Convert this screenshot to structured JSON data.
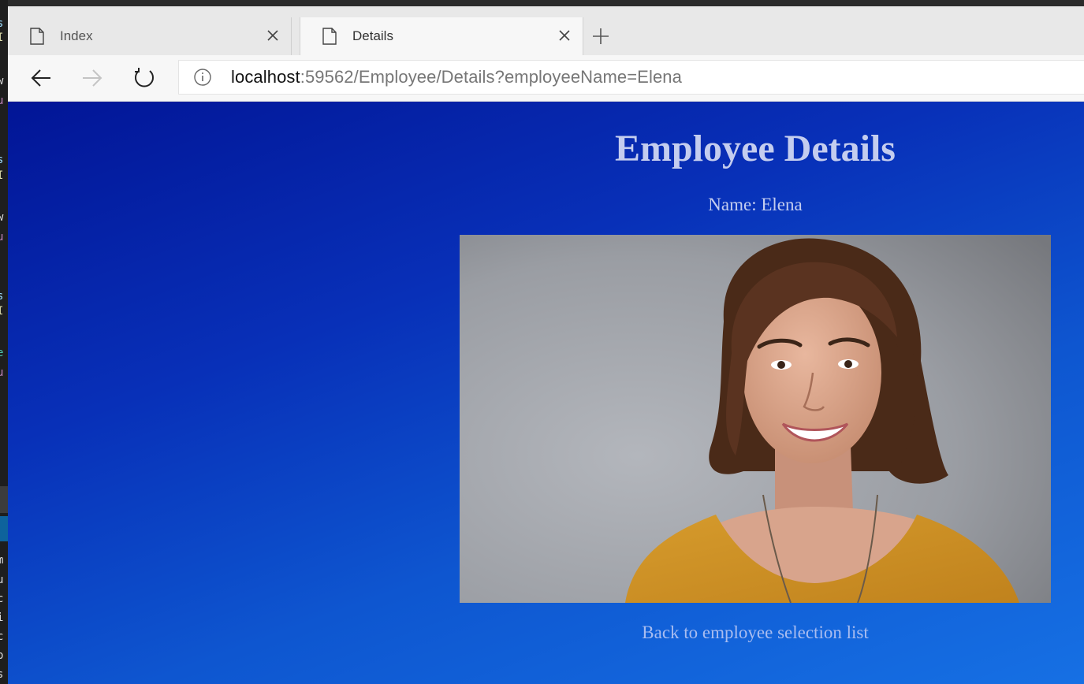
{
  "tabs": [
    {
      "label": "Index",
      "active": false
    },
    {
      "label": "Details",
      "active": true
    }
  ],
  "address_bar": {
    "host": "localhost",
    "rest": ":59562/Employee/Details?employeeName=Elena"
  },
  "page": {
    "title": "Employee Details",
    "name_line": "Name: Elena",
    "back_link": "Back to employee selection list"
  },
  "colors": {
    "background_gradient_start": "#021596",
    "background_gradient_end": "#1670e4",
    "heading_text": "#c4cdef",
    "link_text": "#a9bdf0"
  }
}
